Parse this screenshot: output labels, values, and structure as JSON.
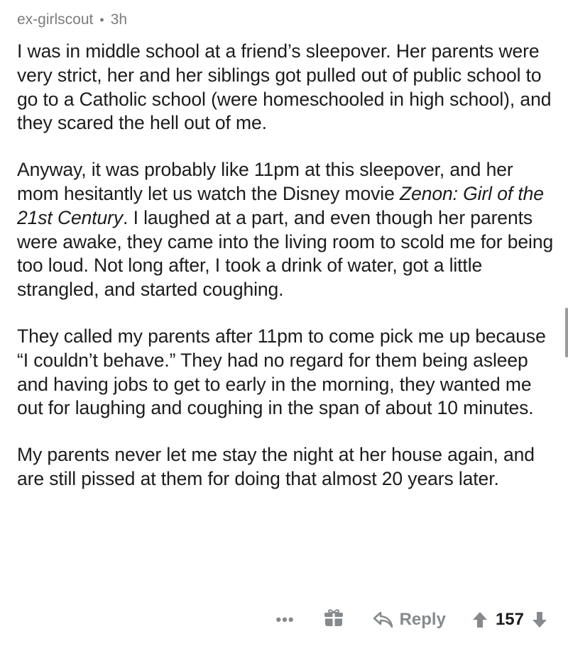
{
  "comment": {
    "username": "ex-girlscout",
    "separator": "•",
    "time": "3h",
    "paragraphs": [
      "I was in middle school at a friend’s sleepover. Her parents were very strict, her and her siblings got pulled out of public school to go to a Catholic school (were homeschooled in high school), and they scared the hell out of me.",
      {
        "before": "Anyway, it was probably like 11pm at this sleepover, and her mom hesitantly let us watch the Disney movie ",
        "italic": "Zenon: Girl of the 21st Century",
        "after": ". I laughed at a part, and even though her parents were awake, they came into the living room to scold me for being too loud. Not long after, I took a drink of water, got a little strangled, and started coughing."
      },
      "They called my parents after 11pm to come pick me up because “I couldn’t behave.” They had no regard for them being asleep and having jobs to get to early in the morning, they wanted me out for laughing and coughing in the span of about 10 minutes.",
      "My parents never let me stay the night at her house again, and are still pissed at them for doing that almost 20 years later."
    ]
  },
  "actions": {
    "more": "•••",
    "gift_icon": "gift-icon",
    "reply_icon": "reply-arrow-icon",
    "reply_label": "Reply",
    "upvote_icon": "upvote-arrow-icon",
    "score": "157",
    "downvote_icon": "downvote-arrow-icon"
  },
  "colors": {
    "text": "#1c1c1c",
    "meta": "#7c7c7c",
    "action": "#878a8c"
  }
}
